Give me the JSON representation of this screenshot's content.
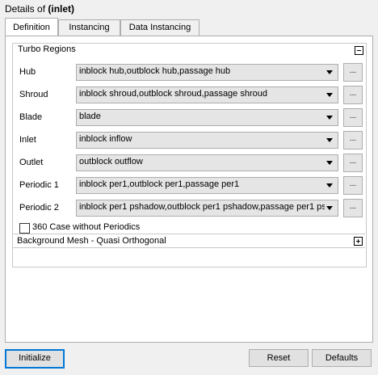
{
  "window": {
    "title_prefix": "Details of ",
    "title_object": "(inlet)"
  },
  "tabs": [
    {
      "label": "Definition",
      "active": true
    },
    {
      "label": "Instancing",
      "active": false
    },
    {
      "label": "Data Instancing",
      "active": false
    }
  ],
  "turbo_regions": {
    "title": "Turbo Regions",
    "rows": [
      {
        "label": "Hub",
        "value": "inblock hub,outblock hub,passage hub"
      },
      {
        "label": "Shroud",
        "value": "inblock shroud,outblock shroud,passage shroud"
      },
      {
        "label": "Blade",
        "value": "blade"
      },
      {
        "label": "Inlet",
        "value": "inblock inflow"
      },
      {
        "label": "Outlet",
        "value": "outblock outflow"
      },
      {
        "label": "Periodic 1",
        "value": "inblock per1,outblock per1,passage per1"
      },
      {
        "label": "Periodic 2",
        "value": "inblock per1 pshadow,outblock per1 pshadow,passage per1 ps"
      }
    ],
    "browse_label": "...",
    "checkbox_label": "360 Case without Periodics",
    "checkbox_checked": false
  },
  "background_mesh": {
    "title": "Background Mesh - Quasi Orthogonal"
  },
  "buttons": {
    "initialize": "Initialize",
    "reset": "Reset",
    "defaults": "Defaults"
  }
}
